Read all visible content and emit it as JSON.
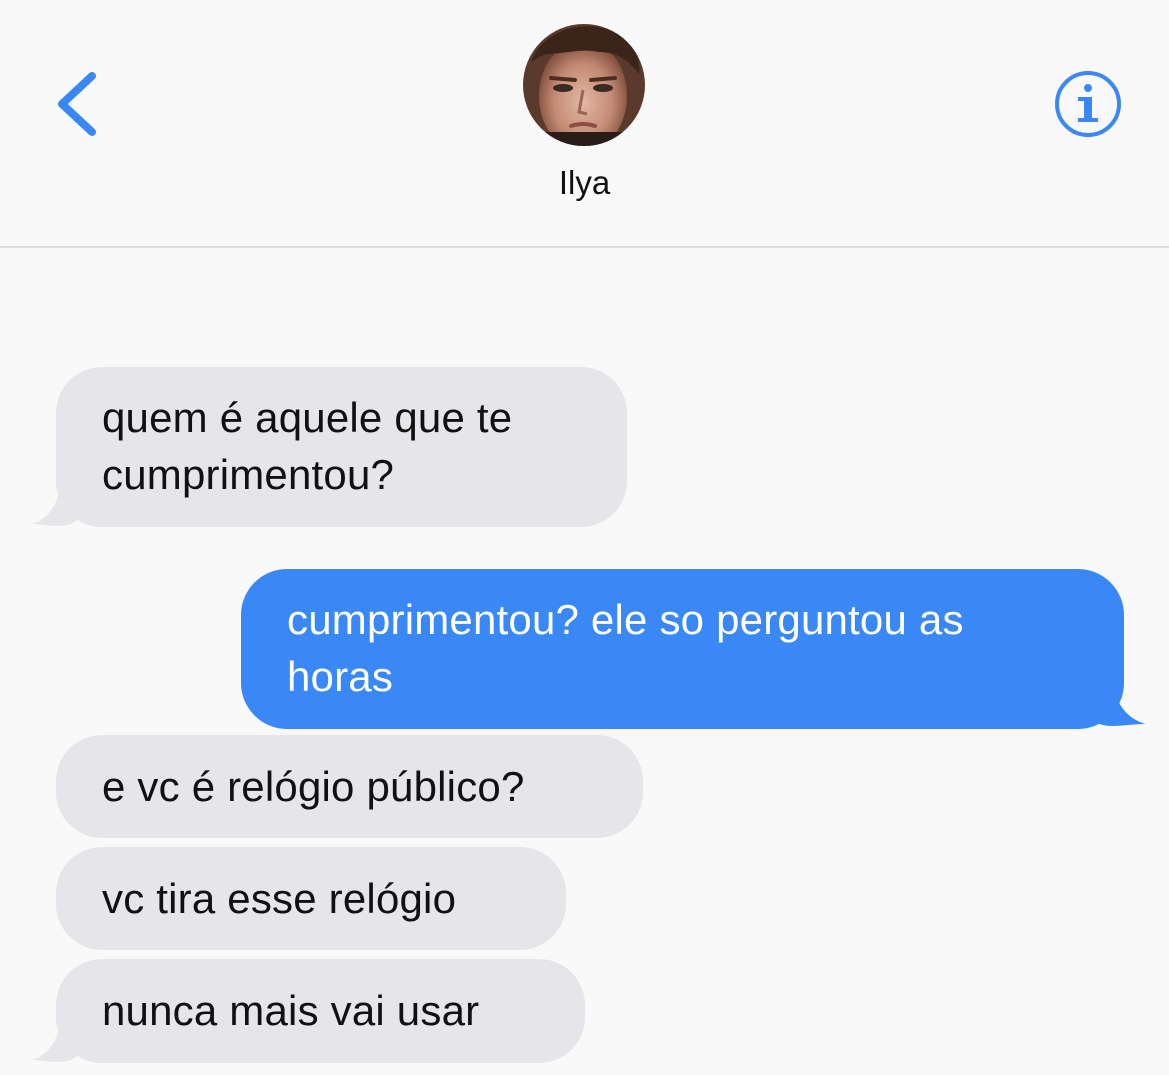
{
  "header": {
    "back_icon": "chevron-left-icon",
    "info_icon": "info-circle-icon",
    "contact_name": "Ilya",
    "accent_color": "#3a88f5"
  },
  "messages": [
    {
      "direction": "incoming",
      "text": "quem é aquele que te\ncumprimentou?"
    },
    {
      "direction": "outgoing",
      "text": "cumprimentou? ele so perguntou as\nhoras"
    },
    {
      "direction": "incoming",
      "text": "e vc é relógio público?"
    },
    {
      "direction": "incoming",
      "text": "vc tira esse relógio"
    },
    {
      "direction": "incoming",
      "text": "nunca mais vai usar"
    }
  ],
  "colors": {
    "incoming_bubble": "#e5e5ea",
    "outgoing_bubble": "#3a88f5",
    "background": "#f9f9f9"
  }
}
